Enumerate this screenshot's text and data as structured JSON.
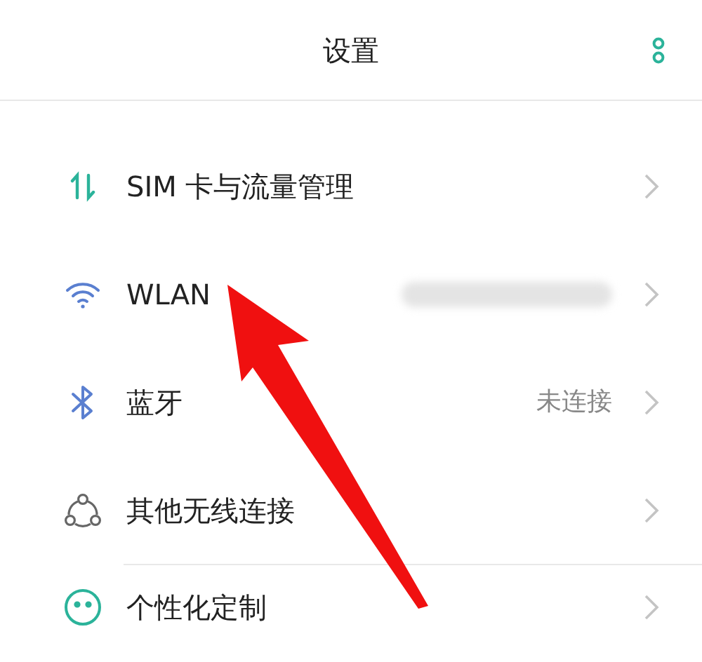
{
  "header": {
    "title": "设置"
  },
  "sections": [
    {
      "items": [
        {
          "label": "SIM 卡与流量管理",
          "value_blurred": false
        },
        {
          "label": "WLAN",
          "value_blurred": true
        },
        {
          "label": "蓝牙",
          "value": "未连接",
          "value_blurred": false
        },
        {
          "label": "其他无线连接",
          "value_blurred": false
        }
      ]
    },
    {
      "items": [
        {
          "label": "个性化定制",
          "value_blurred": false
        }
      ]
    }
  ]
}
